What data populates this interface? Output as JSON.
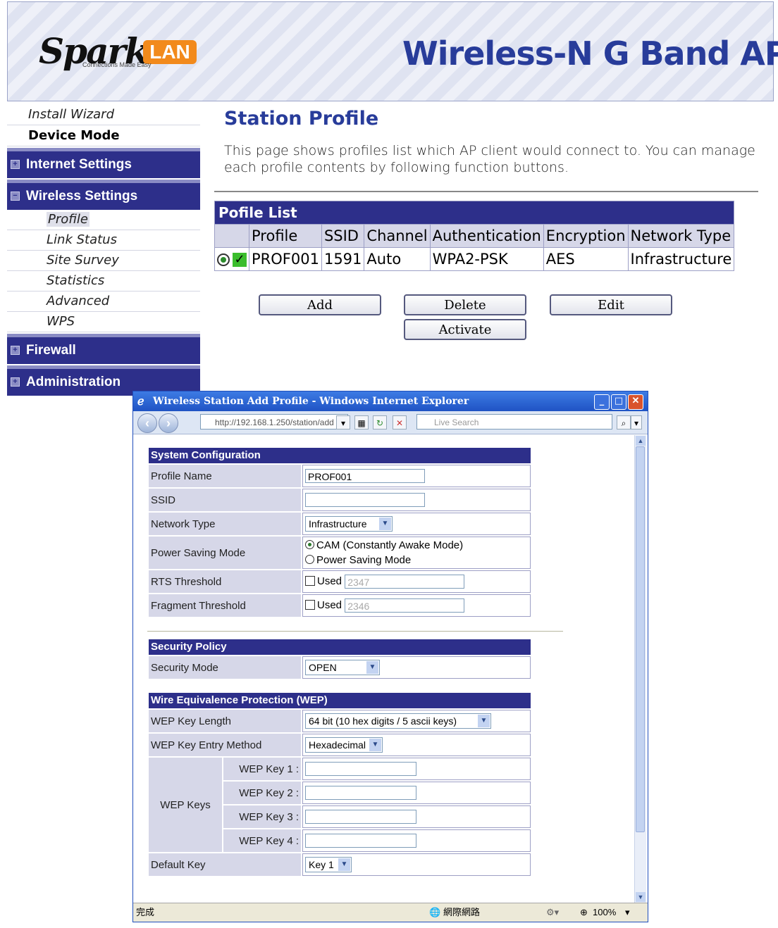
{
  "banner": {
    "logo_text": "SparkLAN",
    "logo_tagline": "Connections Made Easy",
    "title": "Wireless-N G Band AP"
  },
  "sidebar": {
    "install_wizard": "Install Wizard",
    "device_mode": "Device Mode",
    "internet_settings": "Internet Settings",
    "wireless_settings": "Wireless Settings",
    "wireless_items": [
      "Profile",
      "Link Status",
      "Site Survey",
      "Statistics",
      "Advanced",
      "WPS"
    ],
    "firewall": "Firewall",
    "administration": "Administration",
    "expander_plus": "+",
    "expander_minus": "−"
  },
  "main": {
    "title": "Station Profile",
    "description": "This page shows profiles list which AP client would connect to. You can manage each profile contents by following function buttons.",
    "list_caption": "Pofile List",
    "columns": [
      "Profile",
      "SSID",
      "Channel",
      "Authentication",
      "Encryption",
      "Network Type"
    ],
    "rows": [
      [
        "PROF001",
        "1591",
        "Auto",
        "WPA2-PSK",
        "AES",
        "Infrastructure"
      ]
    ],
    "buttons": {
      "add": "Add",
      "delete": "Delete",
      "edit": "Edit",
      "activate": "Activate"
    }
  },
  "ie": {
    "window_title": "Wireless Station Add Profile - Windows Internet Explorer",
    "address": "http://192.168.1.250/station/add",
    "search_placeholder": "Live Search",
    "status_left": "完成",
    "status_zone": "網際網路",
    "zoom": "100%"
  },
  "form": {
    "system_config": {
      "caption": "System Configuration",
      "profile_name_label": "Profile Name",
      "profile_name_value": "PROF001",
      "ssid_label": "SSID",
      "ssid_value": "",
      "network_type_label": "Network Type",
      "network_type_value": "Infrastructure",
      "power_saving_label": "Power Saving Mode",
      "power_option_cam": "CAM (Constantly Awake Mode)",
      "power_option_psm": "Power Saving Mode",
      "rts_label": "RTS Threshold",
      "rts_used": "Used",
      "rts_value": "2347",
      "frag_label": "Fragment Threshold",
      "frag_used": "Used",
      "frag_value": "2346"
    },
    "security": {
      "caption": "Security Policy",
      "mode_label": "Security Mode",
      "mode_value": "OPEN"
    },
    "wep": {
      "caption": "Wire Equivalence Protection (WEP)",
      "key_length_label": "WEP Key Length",
      "key_length_value": "64 bit (10 hex digits / 5 ascii keys)",
      "entry_method_label": "WEP Key Entry Method",
      "entry_method_value": "Hexadecimal",
      "keys_label": "WEP Keys",
      "key1": "WEP Key 1 :",
      "key2": "WEP Key 2 :",
      "key3": "WEP Key 3 :",
      "key4": "WEP Key 4 :",
      "default_key_label": "Default Key",
      "default_key_value": "Key 1"
    }
  }
}
